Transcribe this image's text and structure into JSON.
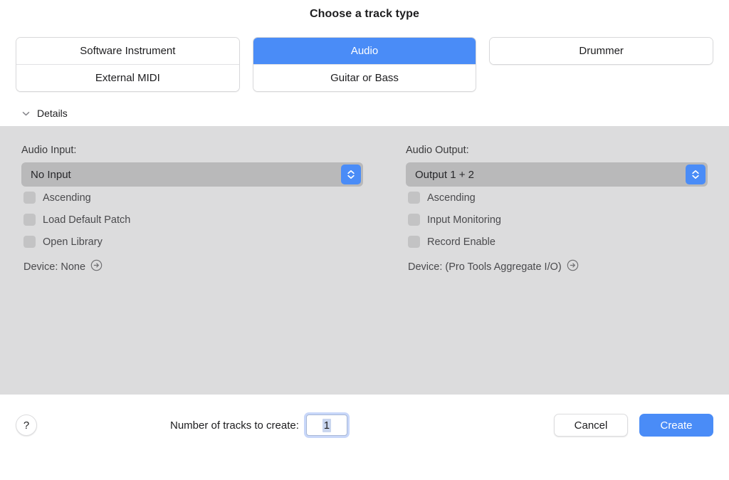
{
  "dialog": {
    "title": "Choose a track type"
  },
  "track_types": {
    "groups": [
      {
        "name": "software-instrument-group",
        "cells": [
          {
            "label": "Software Instrument",
            "selected": false
          },
          {
            "label": "External MIDI",
            "selected": false
          }
        ]
      },
      {
        "name": "audio-group",
        "cells": [
          {
            "label": "Audio",
            "selected": true
          },
          {
            "label": "Guitar or Bass",
            "selected": false
          }
        ]
      },
      {
        "name": "drummer-group",
        "cells": [
          {
            "label": "Drummer",
            "selected": false
          }
        ]
      }
    ],
    "selected": "Audio",
    "selected_color": "#4a8cf7"
  },
  "details": {
    "label": "Details",
    "expanded": true,
    "disclosure_icon": "chevron-down-icon",
    "panel_color": "#dcdcdd",
    "left": {
      "field_label": "Audio Input:",
      "popup_value": "No Input",
      "stepper_icon": "stepper-up-down-icon",
      "checkboxes": [
        {
          "label": "Ascending",
          "checked": false
        },
        {
          "label": "Load Default Patch",
          "checked": false
        },
        {
          "label": "Open Library",
          "checked": false
        }
      ],
      "device_text": "Device: None",
      "device_icon": "arrow-right-circle-icon"
    },
    "right": {
      "field_label": "Audio Output:",
      "popup_value": "Output 1 + 2",
      "stepper_icon": "stepper-up-down-icon",
      "checkboxes": [
        {
          "label": "Ascending",
          "checked": false
        },
        {
          "label": "Input Monitoring",
          "checked": false
        },
        {
          "label": "Record Enable",
          "checked": false
        }
      ],
      "device_text": "Device: (Pro Tools Aggregate I/O)",
      "device_icon": "arrow-right-circle-icon"
    }
  },
  "footer": {
    "help_label": "?",
    "help_icon": "question-mark-icon",
    "tracks_label": "Number of tracks to create:",
    "tracks_value": "1",
    "cancel_label": "Cancel",
    "create_label": "Create",
    "create_color": "#4a8cf7"
  }
}
